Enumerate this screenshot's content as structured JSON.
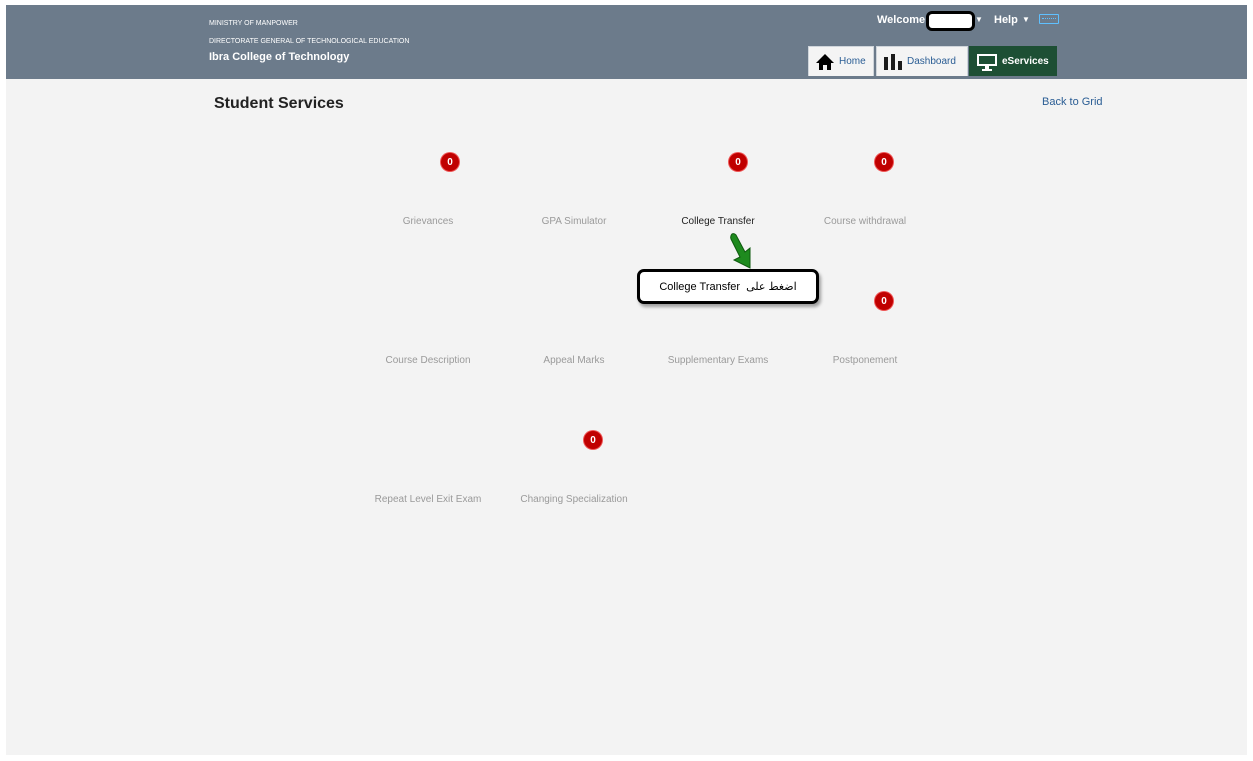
{
  "header": {
    "ministry": "MINISTRY OF MANPOWER",
    "directorate": "DIRECTORATE GENERAL OF TECHNOLOGICAL EDUCATION",
    "college": "Ibra College of Technology",
    "welcome_label": "Welcome",
    "help_label": "Help"
  },
  "nav": {
    "home": "Home",
    "dashboard": "Dashboard",
    "eservices": "eServices",
    "active": "eServices"
  },
  "page": {
    "title": "Student Services",
    "back_link": "Back to Grid"
  },
  "tiles": [
    {
      "label": "Grievances",
      "badge": "0"
    },
    {
      "label": "GPA Simulator"
    },
    {
      "label": "College Transfer",
      "badge": "0"
    },
    {
      "label": "Course withdrawal",
      "badge": "0"
    },
    {
      "label": "Course Description"
    },
    {
      "label": "Appeal Marks"
    },
    {
      "label": "Supplementary Exams"
    },
    {
      "label": "Postponement",
      "badge": "0"
    },
    {
      "label": "Repeat Level Exit Exam"
    },
    {
      "label": "Changing Specialization",
      "badge": "0"
    }
  ],
  "callout": {
    "english": "College Transfer",
    "arabic": "اضغط على"
  },
  "colors": {
    "header_bg": "#6c7b8b",
    "active_tab": "#1d4f34",
    "badge": "#c00000",
    "link": "#2a5d94",
    "arrow": "#1e8a1e"
  },
  "icons": {
    "home": "home-icon",
    "dashboard": "bar-chart-icon",
    "eservices": "monitor-icon",
    "keyboard": "keyboard-icon"
  }
}
